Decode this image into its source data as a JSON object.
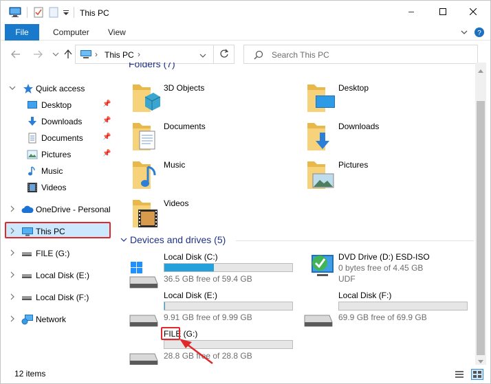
{
  "window": {
    "title": "This PC",
    "minimize_glyph": "─",
    "maximize_glyph": "☐",
    "close_glyph": "✕"
  },
  "ribbon": {
    "tabs": [
      "File",
      "Computer",
      "View"
    ],
    "expand_glyph": "⌄",
    "help_glyph": "?"
  },
  "address": {
    "path": "This PC",
    "separator": "›",
    "search_placeholder": "Search This PC"
  },
  "nav": {
    "back_glyph": "←",
    "forward_glyph": "→",
    "up_glyph": "↑",
    "history_glyph": "⌄",
    "items": [
      {
        "label": "Quick access",
        "icon": "star-icon"
      },
      {
        "label": "Desktop",
        "icon": "desktop-icon",
        "pinned": true
      },
      {
        "label": "Downloads",
        "icon": "download-icon",
        "pinned": true
      },
      {
        "label": "Documents",
        "icon": "documents-icon",
        "pinned": true
      },
      {
        "label": "Pictures",
        "icon": "pictures-icon",
        "pinned": true
      },
      {
        "label": "Music",
        "icon": "music-icon"
      },
      {
        "label": "Videos",
        "icon": "videos-icon"
      },
      {
        "label": "OneDrive - Personal",
        "icon": "cloud-icon"
      },
      {
        "label": "This PC",
        "icon": "computer-icon"
      },
      {
        "label": "FILE (G:)",
        "icon": "drive-icon"
      },
      {
        "label": "Local Disk (E:)",
        "icon": "drive-icon"
      },
      {
        "label": "Local Disk (F:)",
        "icon": "drive-icon"
      },
      {
        "label": "Network",
        "icon": "network-icon"
      }
    ]
  },
  "content": {
    "folders_header": "Folders (7)",
    "folders": [
      {
        "label": "3D Objects",
        "icon": "3d-objects-folder-icon"
      },
      {
        "label": "Desktop",
        "icon": "desktop-folder-icon"
      },
      {
        "label": "Documents",
        "icon": "documents-folder-icon"
      },
      {
        "label": "Downloads",
        "icon": "downloads-folder-icon"
      },
      {
        "label": "Music",
        "icon": "music-folder-icon"
      },
      {
        "label": "Pictures",
        "icon": "pictures-folder-icon"
      },
      {
        "label": "Videos",
        "icon": "videos-folder-icon"
      }
    ],
    "drives_header": "Devices and drives (5)",
    "drives": [
      {
        "name": "Local Disk (C:)",
        "free": "36.5 GB free of 59.4 GB",
        "used_fraction": 0.386
      },
      {
        "name": "DVD Drive (D:) ESD-ISO",
        "free": "0 bytes free of 4.45 GB",
        "fs": "UDF"
      },
      {
        "name": "Local Disk (E:)",
        "free": "9.91 GB free of 9.99 GB",
        "used_fraction": 0.008
      },
      {
        "name": "Local Disk (F:)",
        "free": "69.9 GB free of 69.9 GB",
        "used_fraction": 0.0
      },
      {
        "name_part1": "FILE",
        "name_part2": " (G:)",
        "free": "28.8 GB free of 28.8 GB",
        "used_fraction": 0.0
      }
    ]
  },
  "status": {
    "item_count": "12 items"
  },
  "colors": {
    "accent": "#1979ca",
    "selection": "#cce8ff",
    "highlight_red": "#e0282a",
    "bar_fill": "#26a0da",
    "group_header": "#1e3287"
  }
}
